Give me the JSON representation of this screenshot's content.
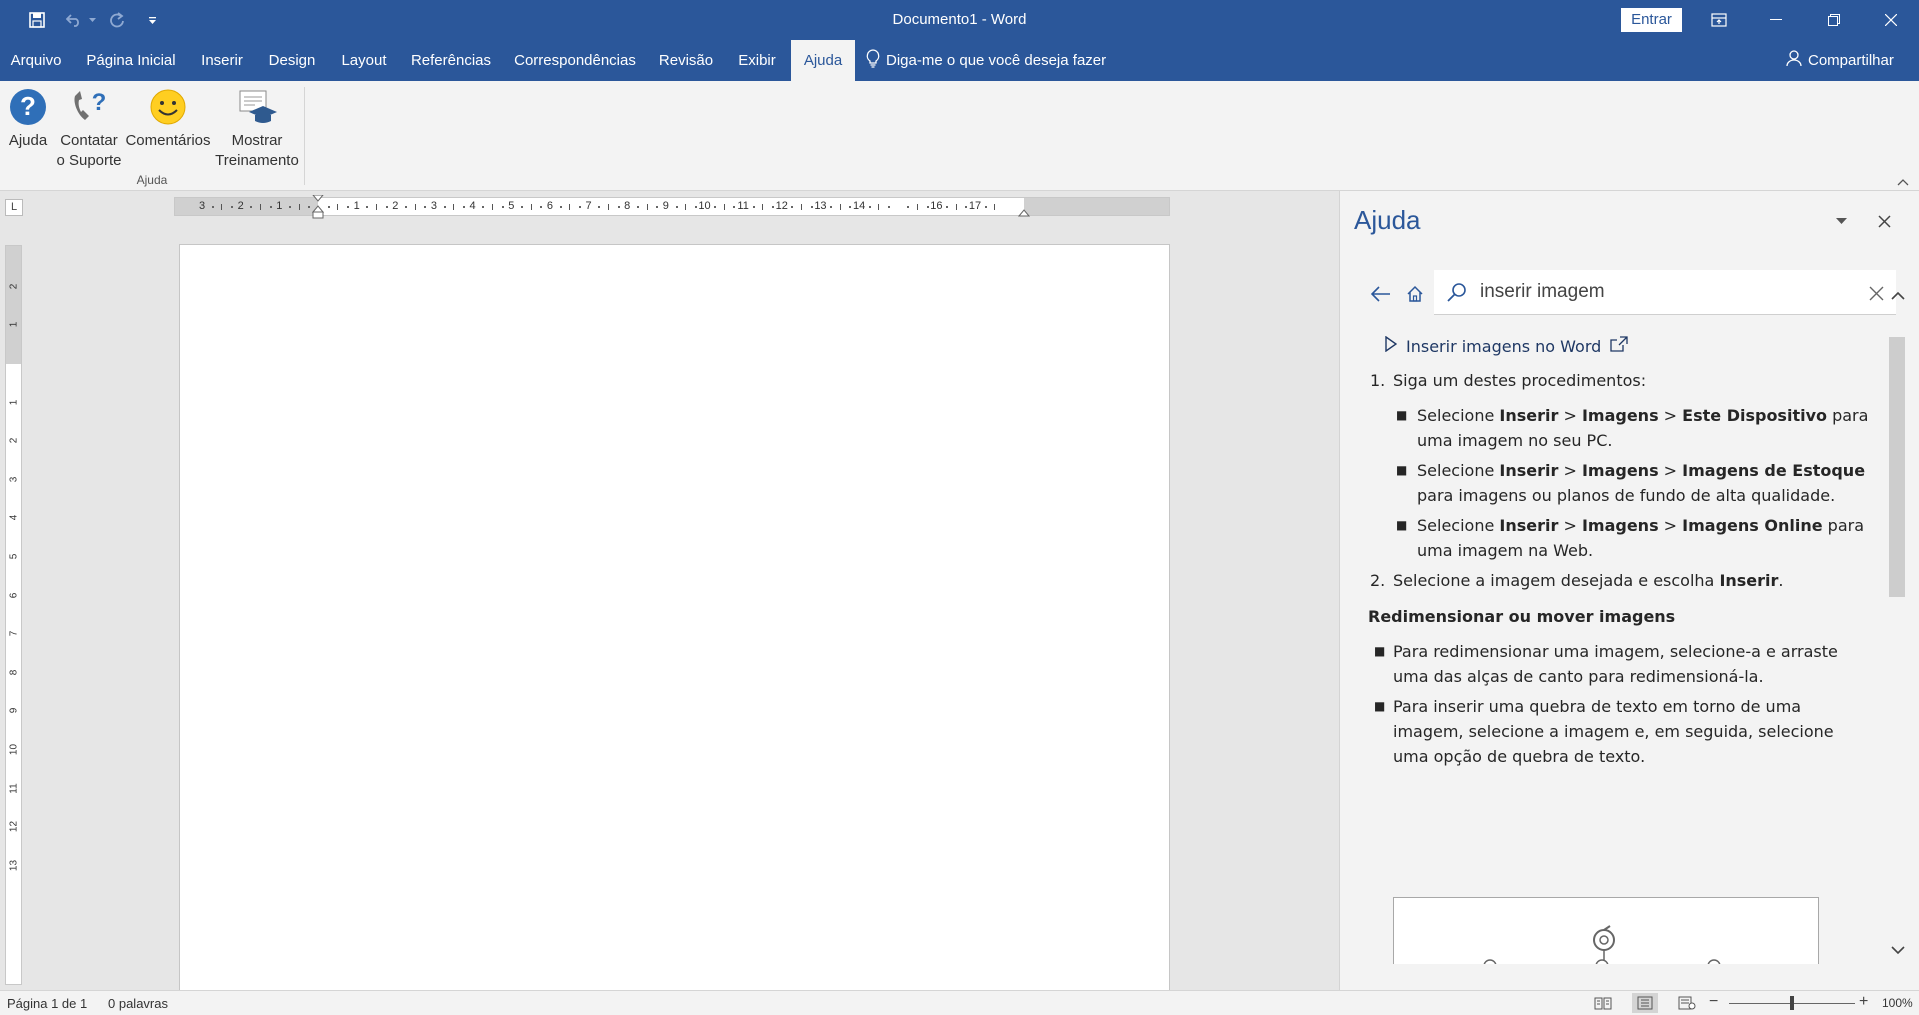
{
  "window": {
    "title": "Documento1  -  Word",
    "signin_label": "Entrar"
  },
  "colors": {
    "brand": "#2b579a",
    "ribbon_bg": "#f3f3f3",
    "workspace_bg": "#e6e6e6",
    "page_bg": "#ffffff",
    "accent_blue": "#1f3864"
  },
  "tabs": [
    {
      "label": "Arquivo"
    },
    {
      "label": "Página Inicial"
    },
    {
      "label": "Inserir"
    },
    {
      "label": "Design"
    },
    {
      "label": "Layout"
    },
    {
      "label": "Referências"
    },
    {
      "label": "Correspondências"
    },
    {
      "label": "Revisão"
    },
    {
      "label": "Exibir"
    },
    {
      "label": "Ajuda",
      "active": true
    }
  ],
  "tellme": {
    "label": "Diga-me o que você deseja fazer",
    "icon": "lightbulb-icon"
  },
  "share": {
    "label": "Compartilhar",
    "icon": "person-icon"
  },
  "ribbon": {
    "group_label": "Ajuda",
    "buttons": [
      {
        "label_line1": "Ajuda",
        "label_line2": "",
        "icon": "help-question-icon"
      },
      {
        "label_line1": "Contatar",
        "label_line2": "o Suporte",
        "icon": "support-phone-icon"
      },
      {
        "label_line1": "Comentários",
        "label_line2": "",
        "icon": "smiley-icon"
      },
      {
        "label_line1": "Mostrar",
        "label_line2": "Treinamento",
        "icon": "training-icon"
      }
    ]
  },
  "rulers": {
    "corner": "L",
    "h_labels": [
      "3",
      "2",
      "1",
      "1",
      "2",
      "3",
      "4",
      "5",
      "6",
      "7",
      "8",
      "9",
      "10",
      "11",
      "12",
      "13",
      "14",
      "16",
      "17"
    ],
    "v_labels": [
      "2",
      "1",
      "1",
      "2",
      "3",
      "4",
      "5",
      "6",
      "7",
      "8",
      "9",
      "10",
      "11",
      "12",
      "13"
    ]
  },
  "help_pane": {
    "title": "Ajuda",
    "search_value": "inserir imagem",
    "video_link": "Inserir imagens no Word",
    "step1": "Siga um destes procedimentos:",
    "sub_items": [
      {
        "pre": "Selecione ",
        "b1": "Inserir",
        "sep1": " > ",
        "b2": "Imagens",
        "sep2": " > ",
        "b3": "Este Dispositivo",
        "post": " para uma imagem no seu PC."
      },
      {
        "pre": "Selecione ",
        "b1": "Inserir",
        "sep1": " > ",
        "b2": "Imagens",
        "sep2": " > ",
        "b3": "Imagens de Estoque",
        "post": " para imagens ou planos de fundo de alta qualidade."
      },
      {
        "pre": "Selecione ",
        "b1": "Inserir",
        "sep1": " > ",
        "b2": "Imagens",
        "sep2": " > ",
        "b3": "Imagens Online",
        "post": " para uma imagem na Web."
      }
    ],
    "step2_pre": "Selecione a imagem desejada e escolha ",
    "step2_bold": "Inserir",
    "step2_post": ".",
    "section_heading": "Redimensionar ou mover imagens",
    "bullets": [
      "Para redimensionar uma imagem, selecione-a e arraste uma das alças de canto para redimensioná-la.",
      "Para inserir uma quebra de texto em torno de uma imagem, selecione a imagem e, em seguida, selecione uma opção de quebra de texto."
    ]
  },
  "status": {
    "page": "Página 1 de 1",
    "words": "0 palavras",
    "zoom": "100%",
    "zoom_fraction": 0.5
  }
}
